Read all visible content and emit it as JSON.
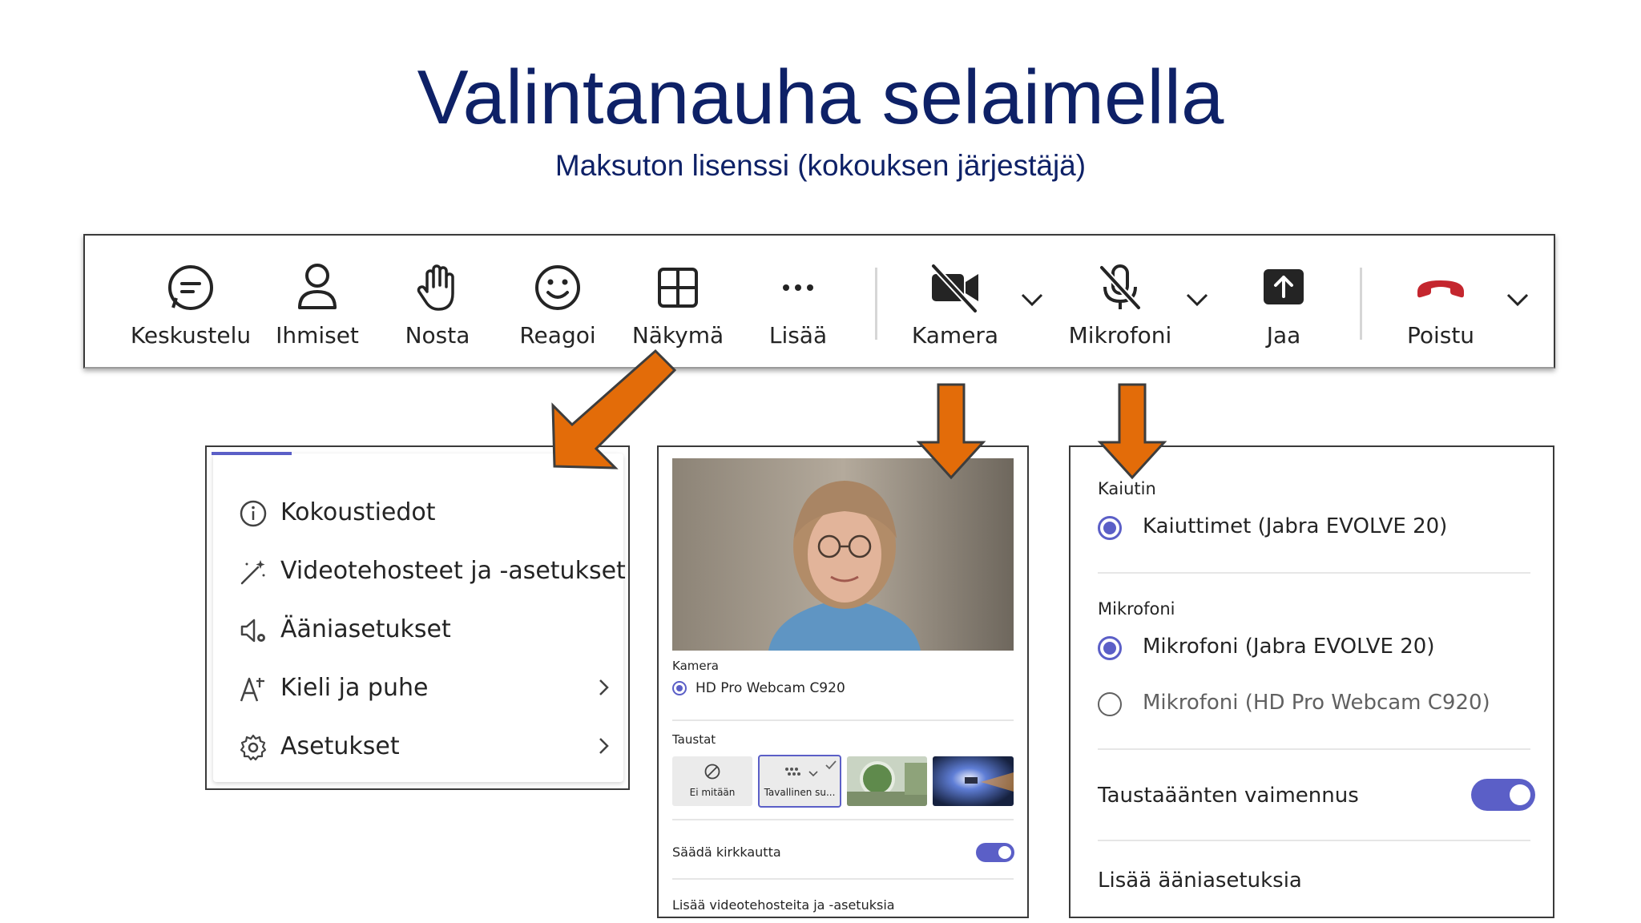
{
  "title": "Valintanauha selaimella",
  "subtitle": "Maksuton lisenssi (kokouksen järjestäjä)",
  "ribbon": {
    "chat": "Keskustelu",
    "people": "Ihmiset",
    "raise": "Nosta",
    "react": "Reagoi",
    "view": "Näkymä",
    "more": "Lisää",
    "camera": "Kamera",
    "mic": "Mikrofoni",
    "share": "Jaa",
    "leave": "Poistu"
  },
  "more_menu": {
    "items": [
      "Kokoustiedot",
      "Videotehosteet ja -asetukset",
      "Ääniasetukset",
      "Kieli ja puhe",
      "Asetukset"
    ]
  },
  "camera_panel": {
    "camera_heading": "Kamera",
    "camera_device": "HD Pro Webcam C920",
    "backgrounds_heading": "Taustat",
    "bg_none": "Ei mitään",
    "bg_standard": "Tavallinen su...",
    "brightness_label": "Säädä kirkkautta",
    "brightness_on": true,
    "more_link": "Lisää videotehosteita ja -asetuksia"
  },
  "audio_panel": {
    "speaker_heading": "Kaiutin",
    "speaker_device": "Kaiuttimet (Jabra EVOLVE 20)",
    "mic_heading": "Mikrofoni",
    "mic_device_1": "Mikrofoni (Jabra EVOLVE 20)",
    "mic_device_2": "Mikrofoni (HD Pro Webcam C920)",
    "noise_label": "Taustaäänten vaimennus",
    "noise_on": true,
    "more_link": "Lisää ääniasetuksia"
  },
  "colors": {
    "title": "#0e2167",
    "arrow": "#e36c09",
    "accent": "#5b5fc7",
    "leave": "#c4262e"
  }
}
